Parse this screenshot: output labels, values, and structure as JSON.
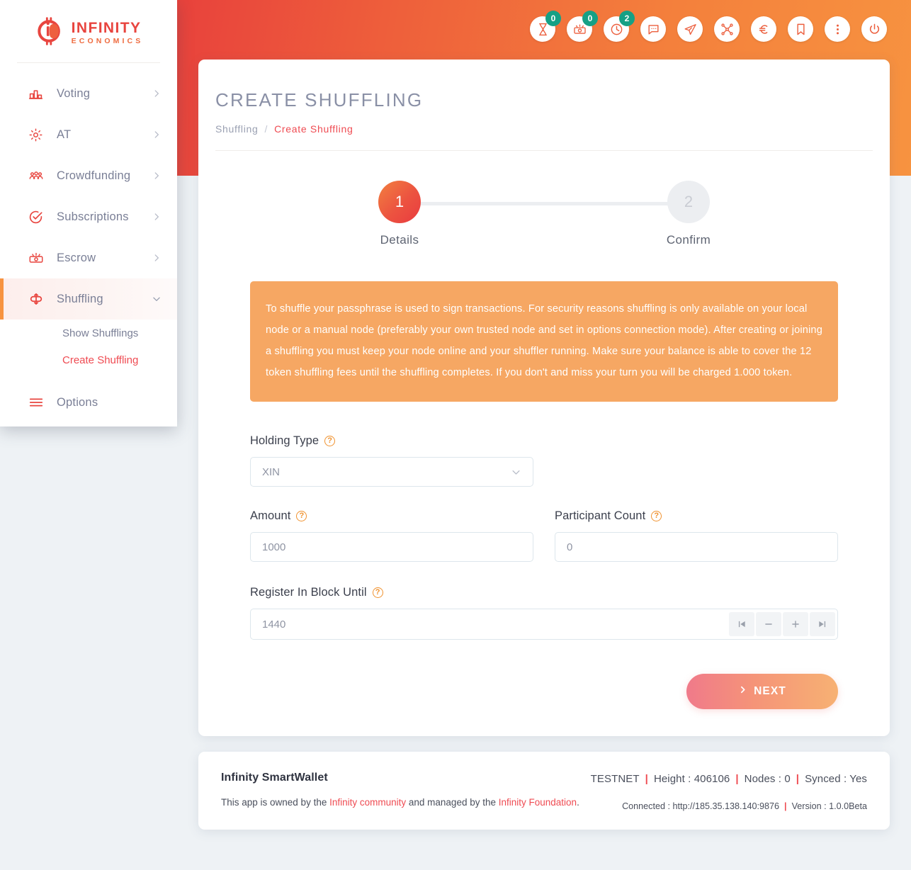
{
  "brand": {
    "name_line1": "INFINITY",
    "name_line2": "ECONOMICS",
    "accent_red": "#e8453f",
    "accent_orange": "#f79340"
  },
  "topbar": {
    "icons": [
      {
        "name": "hourglass-icon",
        "badge": "0"
      },
      {
        "name": "handshake-money-icon",
        "badge": "0"
      },
      {
        "name": "clock-icon",
        "badge": "2"
      },
      {
        "name": "chat-icon",
        "badge": ""
      },
      {
        "name": "paper-plane-icon",
        "badge": ""
      },
      {
        "name": "network-share-icon",
        "badge": ""
      },
      {
        "name": "euro-icon",
        "badge": ""
      },
      {
        "name": "bookmark-icon",
        "badge": ""
      },
      {
        "name": "more-vertical-icon",
        "badge": ""
      },
      {
        "name": "power-icon",
        "badge": ""
      }
    ]
  },
  "sidebar": {
    "items": [
      {
        "label": "Voting",
        "icon": "bar-chart-icon",
        "chevron": "right"
      },
      {
        "label": "AT",
        "icon": "gear-icon",
        "chevron": "right"
      },
      {
        "label": "Crowdfunding",
        "icon": "crowd-icon",
        "chevron": "right"
      },
      {
        "label": "Subscriptions",
        "icon": "check-circle-icon",
        "chevron": "right"
      },
      {
        "label": "Escrow",
        "icon": "escrow-icon",
        "chevron": "right"
      },
      {
        "label": "Shuffling",
        "icon": "shuffle-icon",
        "chevron": "down"
      }
    ],
    "subitems": [
      {
        "label": "Show Shufflings",
        "active": false
      },
      {
        "label": "Create Shuffling",
        "active": true
      }
    ],
    "options": {
      "label": "Options",
      "icon": "hamburger-icon"
    }
  },
  "page": {
    "title": "CREATE SHUFFLING",
    "breadcrumb_parent": "Shuffling",
    "breadcrumb_sep": "/",
    "breadcrumb_current": "Create Shuffling"
  },
  "stepper": {
    "step1_number": "1",
    "step1_label": "Details",
    "step2_number": "2",
    "step2_label": "Confirm"
  },
  "notice": {
    "text": "To shuffle your passphrase is used to sign transactions. For security reasons shuffling is only available on your local node or a manual node (preferably your own trusted node and set in options connection mode). After creating or joining a shuffling you must keep your node online and your shuffler running. Make sure your balance is able to cover the 12 token shuffling fees until the shuffling completes. If you don't and miss your turn you will be charged 1.000 token."
  },
  "form": {
    "holding_type": {
      "label": "Holding Type",
      "value": "XIN",
      "help": "?"
    },
    "amount": {
      "label": "Amount",
      "placeholder": "1000",
      "help": "?"
    },
    "participant_count": {
      "label": "Participant Count",
      "placeholder": "0",
      "help": "?"
    },
    "register_block": {
      "label": "Register In Block Until",
      "placeholder": "1440",
      "help": "?",
      "buttons": [
        {
          "name": "skip-back-icon",
          "glyph": "⏮"
        },
        {
          "name": "minus-icon",
          "glyph": "−"
        },
        {
          "name": "plus-icon",
          "glyph": "+"
        },
        {
          "name": "skip-forward-icon",
          "glyph": "⏭"
        }
      ]
    },
    "next_button": "NEXT"
  },
  "footer": {
    "app_title": "Infinity SmartWallet",
    "owned_prefix": "This app is owned by the ",
    "community_link": "Infinity community",
    "owned_middle": " and managed by the ",
    "foundation_link": "Infinity Foundation",
    "owned_suffix": ".",
    "network": "TESTNET",
    "height_label": "Height : 406106",
    "nodes_label": "Nodes : 0",
    "synced_label": "Synced : Yes",
    "connected_label": "Connected : http://185.35.138.140:9876",
    "version_label": "Version : 1.0.0Beta",
    "divider": "|"
  }
}
